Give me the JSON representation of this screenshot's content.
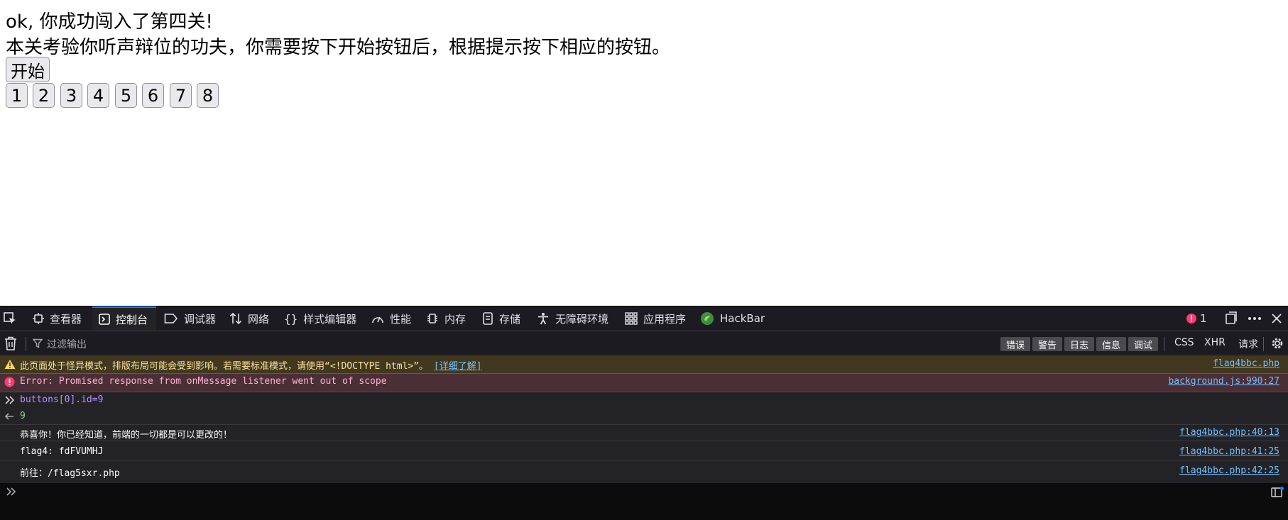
{
  "page": {
    "line1": "ok, 你成功闯入了第四关!",
    "line2": "本关考验你听声辩位的功夫，你需要按下开始按钮后，根据提示按下相应的按钮。",
    "start_label": "开始",
    "number_buttons": [
      "1",
      "2",
      "3",
      "4",
      "5",
      "6",
      "7",
      "8"
    ]
  },
  "devtools": {
    "tabs": {
      "inspector": "查看器",
      "console": "控制台",
      "debugger": "调试器",
      "network": "网络",
      "style_editor": "样式编辑器",
      "performance": "性能",
      "memory": "内存",
      "storage": "存储",
      "accessibility": "无障碍环境",
      "application": "应用程序",
      "hackbar": "HackBar"
    },
    "error_count": "1",
    "toolbar": {
      "filter_placeholder": "过滤输出",
      "levels": [
        "错误",
        "警告",
        "日志",
        "信息",
        "调试"
      ],
      "css": "CSS",
      "xhr": "XHR",
      "requests": "请求"
    },
    "messages": {
      "warning_text": "此页面处于怪异模式，排版布局可能会受到影响。若需要标准模式，请使用“<!DOCTYPE html>”。",
      "warning_link": "[详细了解]",
      "warning_src": "flag4bbc.php",
      "error_text": "Error: Promised response from onMessage listener went out of scope",
      "error_src": "background.js:990:27",
      "command_text": "buttons[0].id=9",
      "result_text": "9",
      "log1_text": "恭喜你！你已经知道，前端的一切都是可以更改的！",
      "log1_src": "flag4bbc.php:40:13",
      "log2_text": "flag4: fdFVUMHJ",
      "log2_src": "flag4bbc.php:41:25",
      "log3_text": "前往：/flag5sxr.php",
      "log3_src": "flag4bbc.php:42:25"
    },
    "colors": {
      "accent": "#0a84ff",
      "warning_bg": "#42381f",
      "error_bg": "#4b2f36",
      "link": "#75bfff"
    }
  }
}
